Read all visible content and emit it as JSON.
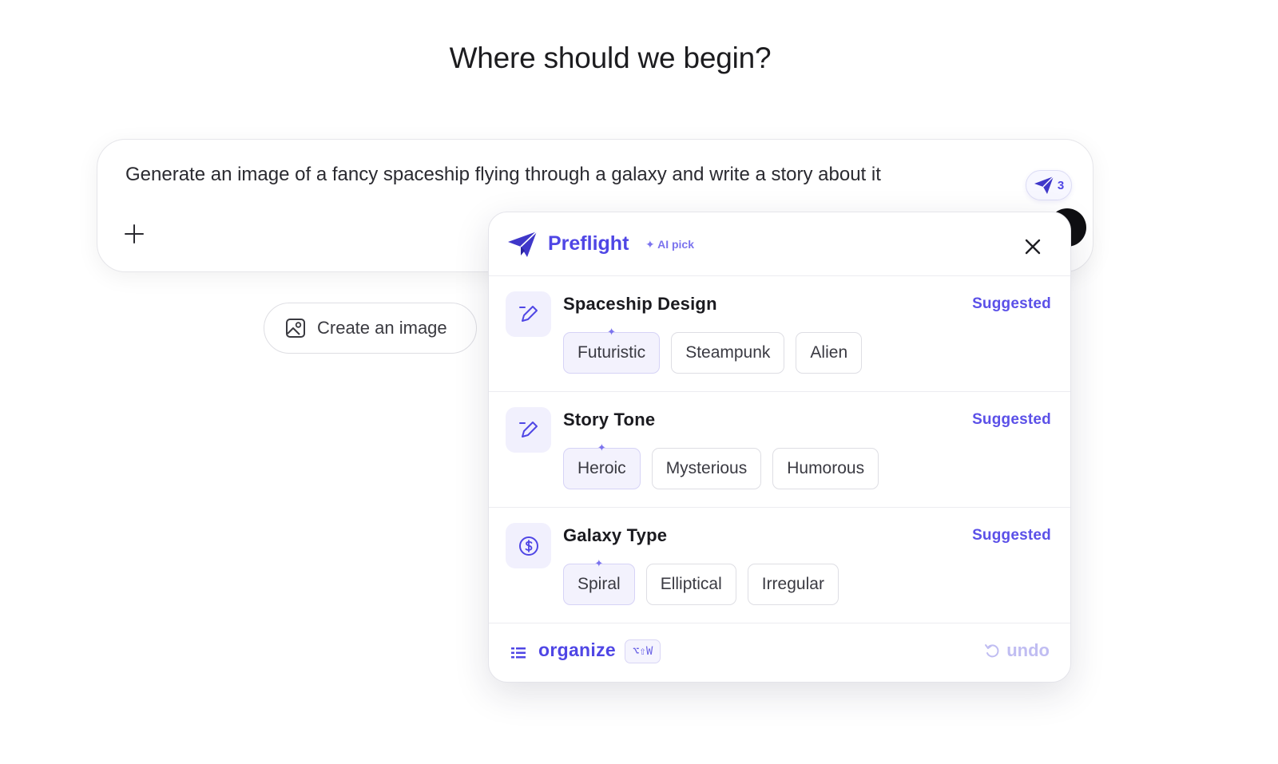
{
  "page": {
    "headline": "Where should we begin?"
  },
  "composer": {
    "prompt": "Generate an image of a fancy spaceship flying through a galaxy and write a story about it",
    "plus_icon": "plus-icon",
    "preflight_badge_count": "3",
    "badge_icon": "paper-plane-icon"
  },
  "suggestions": {
    "create_image_label": "Create an image",
    "create_image_icon": "image-icon"
  },
  "preflight": {
    "title": "Preflight",
    "ai_pick": "✦ AI pick",
    "close_icon": "close-icon",
    "sections": [
      {
        "title": "Spaceship Design",
        "status": "Suggested",
        "icon": "pencil-icon",
        "options": [
          "Futuristic",
          "Steampunk",
          "Alien"
        ],
        "picked_index": 0
      },
      {
        "title": "Story Tone",
        "status": "Suggested",
        "icon": "pencil-icon",
        "options": [
          "Heroic",
          "Mysterious",
          "Humorous"
        ],
        "picked_index": 0
      },
      {
        "title": "Galaxy Type",
        "status": "Suggested",
        "icon": "dollar-circle-icon",
        "options": [
          "Spiral",
          "Elliptical",
          "Irregular"
        ],
        "picked_index": 0
      }
    ],
    "spark_glyph": "✦",
    "footer": {
      "organize_label": "organize",
      "shortcut": "⌥⇧W",
      "undo_label": "undo"
    }
  },
  "colors": {
    "accent": "#4f46e5",
    "accent_soft": "#f1f0fd",
    "muted_accent": "#c0bdf2"
  }
}
